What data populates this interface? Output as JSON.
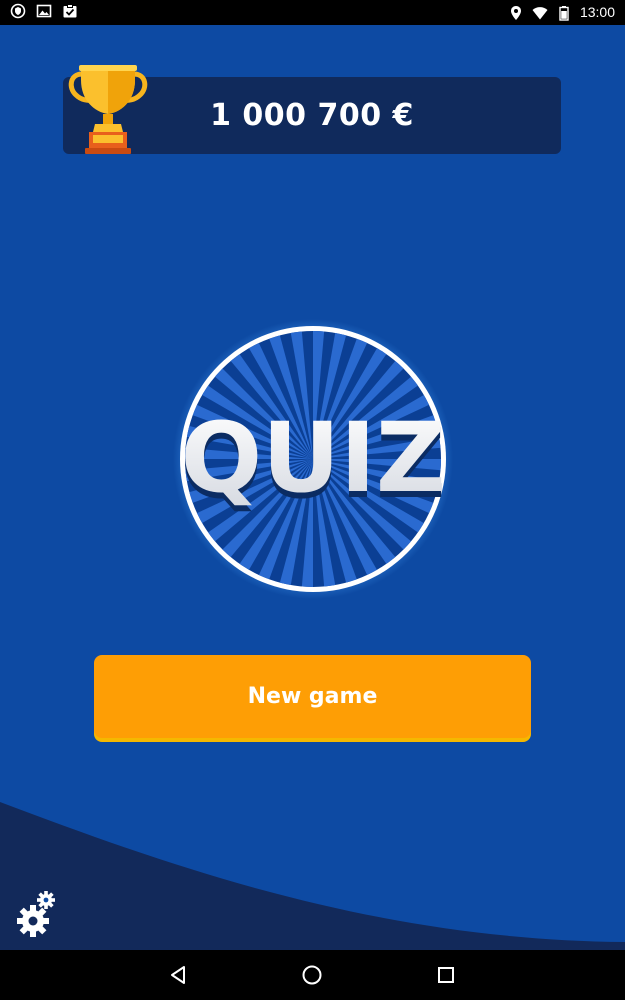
{
  "status_bar": {
    "time": "13:00",
    "left_icons": [
      "shield-icon",
      "image-icon",
      "clipboard-check-icon"
    ],
    "right_icons": [
      "location-icon",
      "wifi-icon",
      "battery-icon"
    ]
  },
  "header": {
    "score": "1 000 700 €",
    "trophy_icon": "trophy-icon"
  },
  "logo": {
    "text": "QUIZ"
  },
  "main": {
    "new_game_label": "New game"
  },
  "footer": {
    "settings_icon": "gears-icon"
  },
  "nav_bar": {
    "buttons": [
      "back-icon",
      "home-icon",
      "recents-icon"
    ]
  },
  "colors": {
    "background": "#0d4aa3",
    "panel": "#102a5c",
    "button": "#fe9e05",
    "wave": "#12295a"
  }
}
